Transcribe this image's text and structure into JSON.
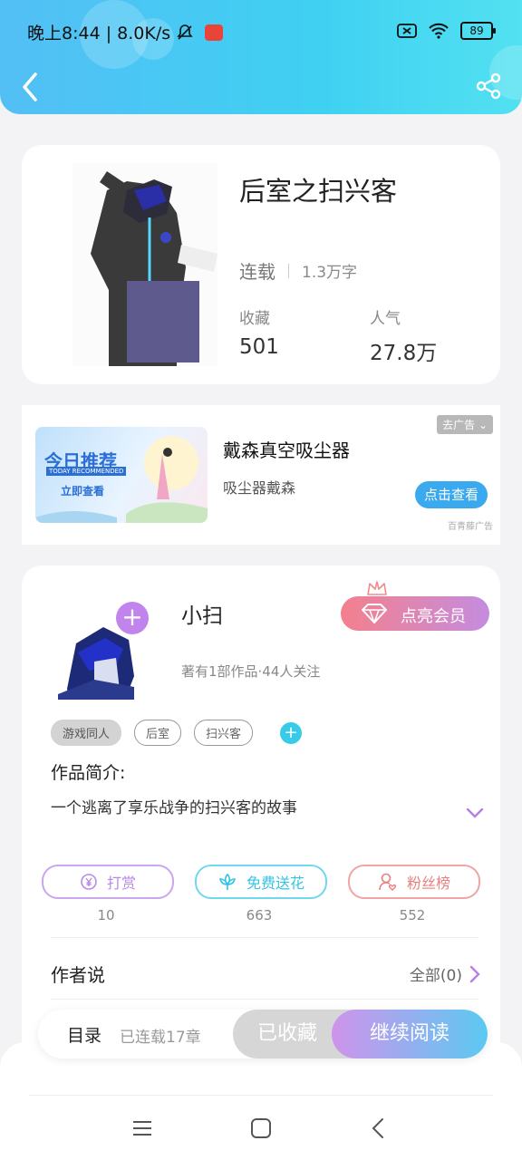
{
  "status_bar": {
    "time_speed": "晚上8:44 | 8.0K/s",
    "battery": "89"
  },
  "book": {
    "title": "后室之扫兴客",
    "status": "连载",
    "word_count": "1.3万字",
    "collect_label": "收藏",
    "collect_value": "501",
    "popularity_label": "人气",
    "popularity_value": "27.8万"
  },
  "ad": {
    "image_title": "今日推荐",
    "image_subtitle": "TODAY RECOMMENDED",
    "image_cta": "立即查看",
    "title": "戴森真空吸尘器",
    "subtitle": "吸尘器戴森",
    "close_label": "去广告",
    "cta": "点击查看",
    "source": "百青藤广告"
  },
  "author": {
    "name": "小扫",
    "meta": "著有1部作品·44人关注",
    "vip_button": "点亮会员",
    "tags": [
      "游戏同人",
      "后室",
      "扫兴客"
    ],
    "intro_label": "作品简介:",
    "intro_text": "一个逃离了享乐战争的扫兴客的故事",
    "actions": [
      {
        "label": "打赏",
        "count": "10"
      },
      {
        "label": "免费送花",
        "count": "663"
      },
      {
        "label": "粉丝榜",
        "count": "552"
      }
    ],
    "author_says_label": "作者说",
    "all_label": "全部(0)"
  },
  "bottom_bar": {
    "toc": "目录",
    "serial": "已连载17章",
    "collected": "已收藏",
    "read": "继续阅读"
  },
  "colors": {
    "header": "#4fc6f4",
    "accent_purple": "#c184ec",
    "accent_cyan": "#38cbe8",
    "accent_red": "#ef7d7d"
  }
}
